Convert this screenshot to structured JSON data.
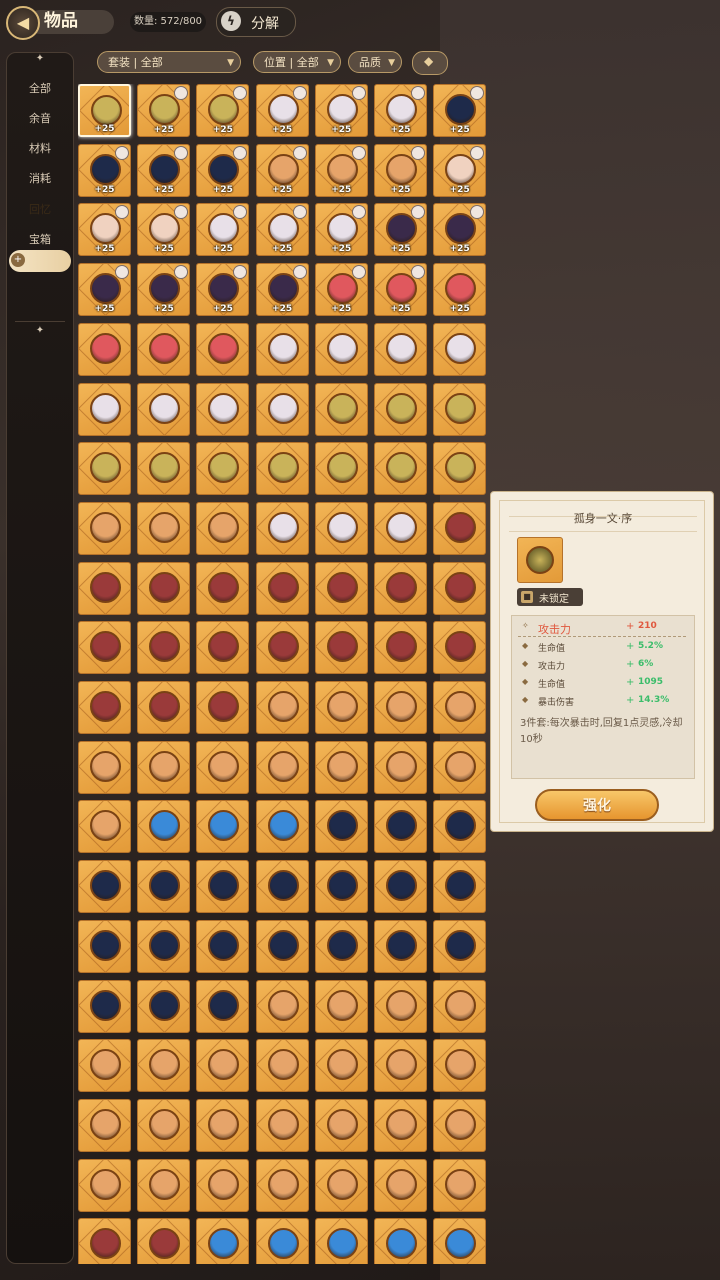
{
  "header": {
    "title": "物品",
    "count_label": "数量: 572/800",
    "decompose_label": "分解",
    "back_icon": "back-arrow-icon",
    "decompose_icon": "decompose-icon"
  },
  "sidebar": {
    "items": [
      {
        "label": "全部"
      },
      {
        "label": "余音"
      },
      {
        "label": "材料"
      },
      {
        "label": "消耗"
      },
      {
        "label": "回忆"
      },
      {
        "label": "宝箱"
      }
    ],
    "active_index": 4
  },
  "filters": {
    "set": "套装 | 全部",
    "position": "位置 | 全部",
    "quality": "品质",
    "sort_icon": "sort-toggle-icon"
  },
  "grid": {
    "columns": 7,
    "level_label": "+25",
    "colors": {
      "gold": "#c9b35a",
      "night": "#1e2a4a",
      "face": "#f0d2c0",
      "pink": "#e0585e",
      "silver": "#e8e0e8",
      "dark": "#3a2a4a",
      "bronze": "#e6a46a",
      "red": "#9a3a3a",
      "blue": "#3a8ad8"
    },
    "rows": [
      [
        "gold",
        "gold",
        "gold",
        "silver",
        "silver",
        "silver",
        "night"
      ],
      [
        "night",
        "night",
        "night",
        "bronze",
        "bronze",
        "bronze",
        "face"
      ],
      [
        "face",
        "face",
        "silver",
        "silver",
        "silver",
        "dark",
        "dark"
      ],
      [
        "dark",
        "dark",
        "dark",
        "dark",
        "pink",
        "pink",
        "pink"
      ],
      [
        "pink",
        "pink",
        "pink",
        "silver",
        "silver",
        "silver",
        "silver"
      ],
      [
        "silver",
        "silver",
        "silver",
        "silver",
        "gold",
        "gold",
        "gold"
      ],
      [
        "gold",
        "gold",
        "gold",
        "gold",
        "gold",
        "gold",
        "gold"
      ],
      [
        "bronze",
        "bronze",
        "bronze",
        "silver",
        "silver",
        "silver",
        "red"
      ],
      [
        "red",
        "red",
        "red",
        "red",
        "red",
        "red",
        "red"
      ],
      [
        "red",
        "red",
        "red",
        "red",
        "red",
        "red",
        "red"
      ],
      [
        "red",
        "red",
        "red",
        "bronze",
        "bronze",
        "bronze",
        "bronze"
      ],
      [
        "bronze",
        "bronze",
        "bronze",
        "bronze",
        "bronze",
        "bronze",
        "bronze"
      ],
      [
        "bronze",
        "blue",
        "blue",
        "blue",
        "night",
        "night",
        "night"
      ],
      [
        "night",
        "night",
        "night",
        "night",
        "night",
        "night",
        "night"
      ],
      [
        "night",
        "night",
        "night",
        "night",
        "night",
        "night",
        "night"
      ],
      [
        "night",
        "night",
        "night",
        "bronze",
        "bronze",
        "bronze",
        "bronze"
      ],
      [
        "bronze",
        "bronze",
        "bronze",
        "bronze",
        "bronze",
        "bronze",
        "bronze"
      ],
      [
        "bronze",
        "bronze",
        "bronze",
        "bronze",
        "bronze",
        "bronze",
        "bronze"
      ],
      [
        "bronze",
        "bronze",
        "bronze",
        "bronze",
        "bronze",
        "bronze",
        "bronze"
      ],
      [
        "red",
        "red",
        "blue",
        "blue",
        "blue",
        "blue",
        "blue"
      ]
    ],
    "leveled_count": 28,
    "avatar_badge_count": 27,
    "selected_index": 0
  },
  "detail": {
    "title": "孤身一文·序",
    "lock_label": "未锁定",
    "main_stat": {
      "name": "攻击力",
      "plus": "+",
      "value": "210"
    },
    "sub_stats": [
      {
        "name": "生命值",
        "plus": "+",
        "value": "5.2%"
      },
      {
        "name": "攻击力",
        "plus": "+",
        "value": "6%"
      },
      {
        "name": "生命值",
        "plus": "+",
        "value": "1095"
      },
      {
        "name": "暴击伤害",
        "plus": "+",
        "value": "14.3%"
      }
    ],
    "set_effect": "3件套:每次暴击时,回复1点灵感,冷却10秒",
    "enhance_label": "强化"
  }
}
